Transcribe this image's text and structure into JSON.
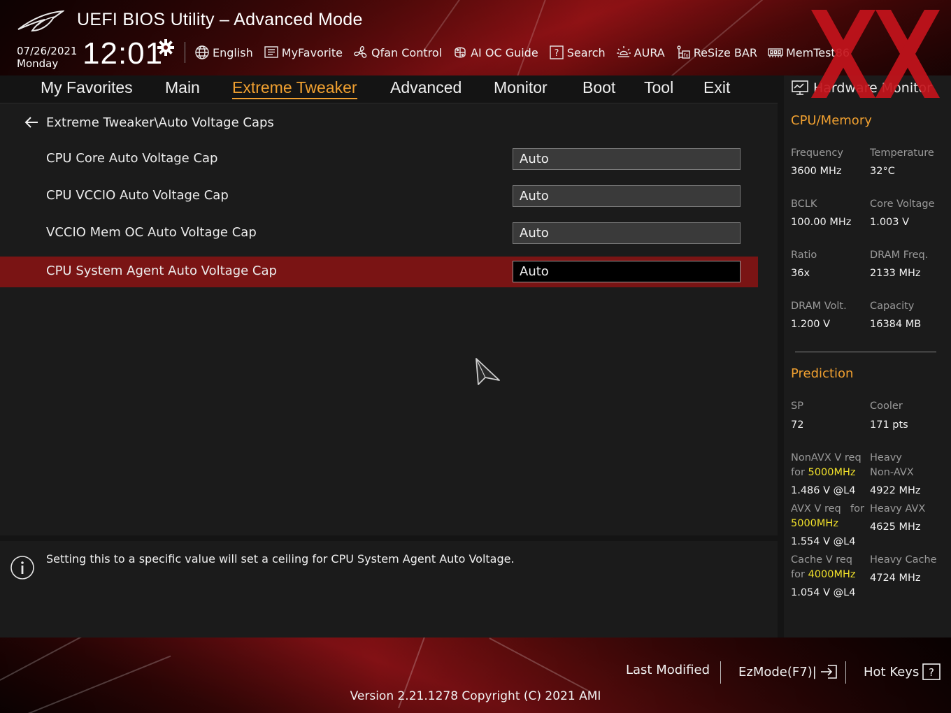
{
  "header": {
    "title": "UEFI BIOS Utility – Advanced Mode",
    "date": "07/26/2021",
    "weekday": "Monday",
    "time": "12:01",
    "toolbar": [
      {
        "icon": "globe-icon",
        "label": "English"
      },
      {
        "icon": "myfavorite-icon",
        "label": "MyFavorite"
      },
      {
        "icon": "fan-icon",
        "label": "Qfan Control"
      },
      {
        "icon": "ai-oc-icon",
        "label": "AI OC Guide"
      },
      {
        "icon": "search-icon",
        "label": "Search"
      },
      {
        "icon": "aura-icon",
        "label": "AURA"
      },
      {
        "icon": "resize-bar-icon",
        "label": "ReSize BAR"
      },
      {
        "icon": "memtest-icon",
        "label": "MemTest86"
      }
    ]
  },
  "nav": {
    "tabs": [
      "My Favorites",
      "Main",
      "Extreme Tweaker",
      "Advanced",
      "Monitor",
      "Boot",
      "Tool",
      "Exit"
    ],
    "active": "Extreme Tweaker"
  },
  "main": {
    "breadcrumb": "Extreme Tweaker\\Auto Voltage Caps",
    "settings": [
      {
        "label": "CPU Core Auto Voltage Cap",
        "value": "Auto",
        "selected": false
      },
      {
        "label": "CPU VCCIO Auto Voltage Cap",
        "value": "Auto",
        "selected": false
      },
      {
        "label": "VCCIO Mem OC Auto Voltage Cap",
        "value": "Auto",
        "selected": false
      },
      {
        "label": "CPU System Agent Auto Voltage Cap",
        "value": "Auto",
        "selected": true
      }
    ]
  },
  "help": {
    "text": "Setting this to a specific value will set a ceiling for CPU System Agent Auto Voltage."
  },
  "hardware_monitor": {
    "title": "Hardware Monitor",
    "cpu_memory": {
      "title": "CPU/Memory",
      "frequency_label": "Frequency",
      "frequency": "3600 MHz",
      "temperature_label": "Temperature",
      "temperature": "32°C",
      "bclk_label": "BCLK",
      "bclk": "100.00 MHz",
      "core_voltage_label": "Core Voltage",
      "core_voltage": "1.003 V",
      "ratio_label": "Ratio",
      "ratio": "36x",
      "dram_freq_label": "DRAM Freq.",
      "dram_freq": "2133 MHz",
      "dram_volt_label": "DRAM Volt.",
      "dram_volt": "1.200 V",
      "capacity_label": "Capacity",
      "capacity": "16384 MB"
    },
    "prediction": {
      "title": "Prediction",
      "sp_label": "SP",
      "sp": "72",
      "cooler_label": "Cooler",
      "cooler": "171 pts",
      "nonavx_label": "NonAVX V req",
      "nonavx_for": "for",
      "nonavx_freq": "5000MHz",
      "nonavx_value": "1.486 V @L4",
      "heavy_nonavx_label_1": "Heavy",
      "heavy_nonavx_label_2": "Non-AVX",
      "heavy_nonavx_value": "4922 MHz",
      "avx_label": "AVX V req",
      "avx_for": "for",
      "avx_freq": "5000MHz",
      "avx_value": "1.554 V @L4",
      "heavy_avx_label": "Heavy AVX",
      "heavy_avx_value": "4625 MHz",
      "cache_label": "Cache V req",
      "cache_for": "for",
      "cache_freq": "4000MHz",
      "cache_value": "1.054 V @L4",
      "heavy_cache_label": "Heavy Cache",
      "heavy_cache_value": "4724 MHz"
    }
  },
  "footer": {
    "last_modified": "Last Modified",
    "ezmode": "EzMode(F7)|",
    "hot_keys": "Hot Keys",
    "version": "Version 2.21.1278 Copyright (C) 2021 AMI"
  },
  "colors": {
    "accent": "#f0a030",
    "selected_row": "#7a1414",
    "highlight": "#f0e02a",
    "panel": "#1b1b1b"
  }
}
